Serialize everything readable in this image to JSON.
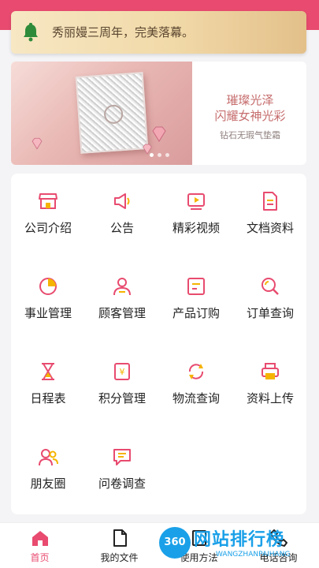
{
  "notice": {
    "text": "秀丽嫚三周年，完美落幕。",
    "icon": "bell-icon"
  },
  "banner": {
    "line1": "璀璨光泽",
    "line2": "闪耀女神光彩",
    "line3": "钻石无瑕气垫霜",
    "page_count": 3,
    "active_index": 0
  },
  "colors": {
    "accent": "#e84b6f",
    "notice_bg": "#f1d9a8",
    "icon_pink": "#e84b6f",
    "icon_yellow": "#f5b400"
  },
  "menu": [
    {
      "label": "公司介绍",
      "icon": "store-icon"
    },
    {
      "label": "公告",
      "icon": "megaphone-icon"
    },
    {
      "label": "精彩视频",
      "icon": "video-icon"
    },
    {
      "label": "文档资料",
      "icon": "document-icon"
    },
    {
      "label": "事业管理",
      "icon": "pie-chart-icon"
    },
    {
      "label": "顾客管理",
      "icon": "person-icon"
    },
    {
      "label": "产品订购",
      "icon": "cart-box-icon"
    },
    {
      "label": "订单查询",
      "icon": "search-icon"
    },
    {
      "label": "日程表",
      "icon": "hourglass-icon"
    },
    {
      "label": "积分管理",
      "icon": "points-icon"
    },
    {
      "label": "物流查询",
      "icon": "refresh-icon"
    },
    {
      "label": "资料上传",
      "icon": "printer-icon"
    },
    {
      "label": "朋友圈",
      "icon": "friends-icon"
    },
    {
      "label": "问卷调查",
      "icon": "chat-icon"
    }
  ],
  "tabs": [
    {
      "label": "首页",
      "icon": "home-icon",
      "active": true
    },
    {
      "label": "我的文件",
      "icon": "file-icon",
      "active": false
    },
    {
      "label": "使用方法",
      "icon": "book-icon",
      "active": false
    },
    {
      "label": "电话咨询",
      "icon": "phone-icon",
      "active": false
    }
  ],
  "watermark": {
    "badge": "360",
    "title": "网站排行榜",
    "url": "WANGZHANPAIHANG"
  }
}
